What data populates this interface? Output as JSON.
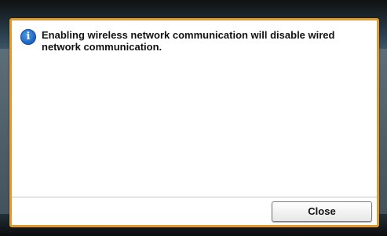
{
  "dialog": {
    "icon": "info-icon",
    "icon_glyph": "i",
    "message": "Enabling wireless network communication will disable wired network communication.",
    "close_label": "Close"
  },
  "colors": {
    "dialog_border": "#e49a2a",
    "info_icon": "#1a62c4"
  }
}
